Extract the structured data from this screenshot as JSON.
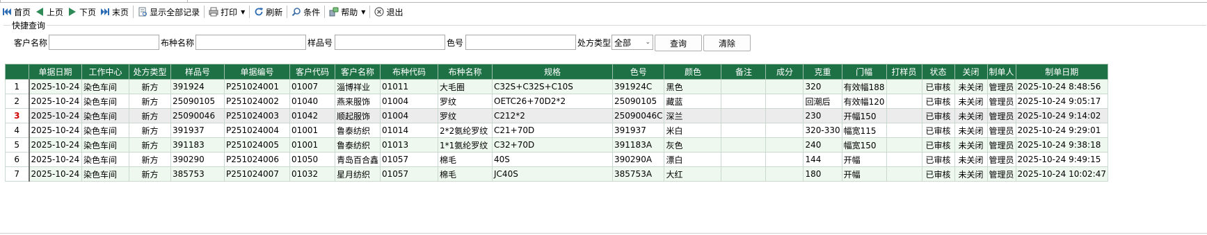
{
  "toolbar": {
    "items": [
      {
        "label": "首页",
        "icon": "first-page-icon"
      },
      {
        "label": "上页",
        "icon": "prev-page-icon"
      },
      {
        "label": "下页",
        "icon": "next-page-icon"
      },
      {
        "label": "末页",
        "icon": "last-page-icon"
      },
      {
        "label": "显示全部记录",
        "icon": "show-all-icon"
      },
      {
        "label": "打印",
        "icon": "print-icon"
      },
      {
        "label": "刷新",
        "icon": "refresh-icon"
      },
      {
        "label": "条件",
        "icon": "search-icon"
      },
      {
        "label": "帮助",
        "icon": "help-icon"
      },
      {
        "label": "退出",
        "icon": "exit-icon"
      }
    ]
  },
  "quick_search": {
    "title": "快捷查询",
    "customer_name_label": "客户名称",
    "customer_name_value": "",
    "fabric_name_label": "布种名称",
    "fabric_name_value": "",
    "sample_no_label": "样品号",
    "sample_no_value": "",
    "color_no_label": "色号",
    "color_no_value": "",
    "rx_type_label": "处方类型",
    "rx_type_value": "全部",
    "query_button": "查询",
    "clear_button": "清除"
  },
  "table": {
    "columns": [
      "单据日期",
      "工作中心",
      "处方类型",
      "样品号",
      "单据编号",
      "客户代码",
      "客户名称",
      "布种代码",
      "布种名称",
      "规格",
      "色号",
      "颜色",
      "备注",
      "成分",
      "克重",
      "门幅",
      "打样员",
      "状态",
      "关闭",
      "制单人",
      "制单日期"
    ],
    "rows": [
      {
        "rn": "1",
        "cells": [
          "2025-10-24",
          "染色车间",
          "新方",
          "391924",
          "P251024001",
          "01007",
          "淄博祥业",
          "01011",
          "大毛圈",
          "C32S+C32S+C10S",
          "391924C",
          "黑色",
          "",
          "",
          "320",
          "有效幅188",
          "",
          "已审核",
          "未关闭",
          "管理员",
          "2025-10-24 8:48:56"
        ]
      },
      {
        "rn": "2",
        "cells": [
          "2025-10-24",
          "染色车间",
          "新方",
          "25090105",
          "P251024002",
          "01040",
          "燕来服饰",
          "01004",
          "罗纹",
          "OETC26+70D2*2",
          "25090105",
          "藏蓝",
          "",
          "",
          "回潮后",
          "有效幅120",
          "",
          "已审核",
          "未关闭",
          "管理员",
          "2025-10-24 9:05:17"
        ]
      },
      {
        "rn": "3",
        "cells": [
          "2025-10-24",
          "染色车间",
          "新方",
          "25090046",
          "P251024003",
          "01042",
          "顺起服饰",
          "01004",
          "罗纹",
          "C212*2",
          "25090046C",
          "深兰",
          "",
          "",
          "230",
          "开幅150",
          "",
          "已审核",
          "未关闭",
          "管理员",
          "2025-10-24 9:14:02"
        ]
      },
      {
        "rn": "4",
        "cells": [
          "2025-10-24",
          "染色车间",
          "新方",
          "391937",
          "P251024004",
          "01001",
          "鲁泰纺织",
          "01014",
          "2*2氨纶罗纹",
          "C21+70D",
          "391937",
          "米白",
          "",
          "",
          "320-330",
          "幅宽115",
          "",
          "已审核",
          "未关闭",
          "管理员",
          "2025-10-24 9:29:01"
        ]
      },
      {
        "rn": "5",
        "cells": [
          "2025-10-24",
          "染色车间",
          "新方",
          "391183",
          "P251024005",
          "01001",
          "鲁泰纺织",
          "01013",
          "1*1氨纶罗纹",
          "C32+70D",
          "391183A",
          "灰色",
          "",
          "",
          "240",
          "幅宽150",
          "",
          "已审核",
          "未关闭",
          "管理员",
          "2025-10-24 9:38:18"
        ]
      },
      {
        "rn": "6",
        "cells": [
          "2025-10-24",
          "染色车间",
          "新方",
          "390290",
          "P251024006",
          "01050",
          "青岛百合鑫",
          "01057",
          "棉毛",
          "40S",
          "390290A",
          "漂白",
          "",
          "",
          "144",
          "开幅",
          "",
          "已审核",
          "未关闭",
          "管理员",
          "2025-10-24 9:49:15"
        ]
      },
      {
        "rn": "7",
        "cells": [
          "2025-10-24",
          "染色车间",
          "新方",
          "385753",
          "P251024007",
          "01032",
          "星月纺织",
          "01057",
          "棉毛",
          "JC40S",
          "385753A",
          "大红",
          "",
          "",
          "180",
          "开幅",
          "",
          "已审核",
          "未关闭",
          "管理员",
          "2025-10-24 10:02:47"
        ]
      }
    ]
  },
  "colors": {
    "header_bg": "#1e7145",
    "row_alt_bg": "#eef8ee",
    "selected_row_bg": "#ececec",
    "current_row_marker": "#d00000"
  }
}
